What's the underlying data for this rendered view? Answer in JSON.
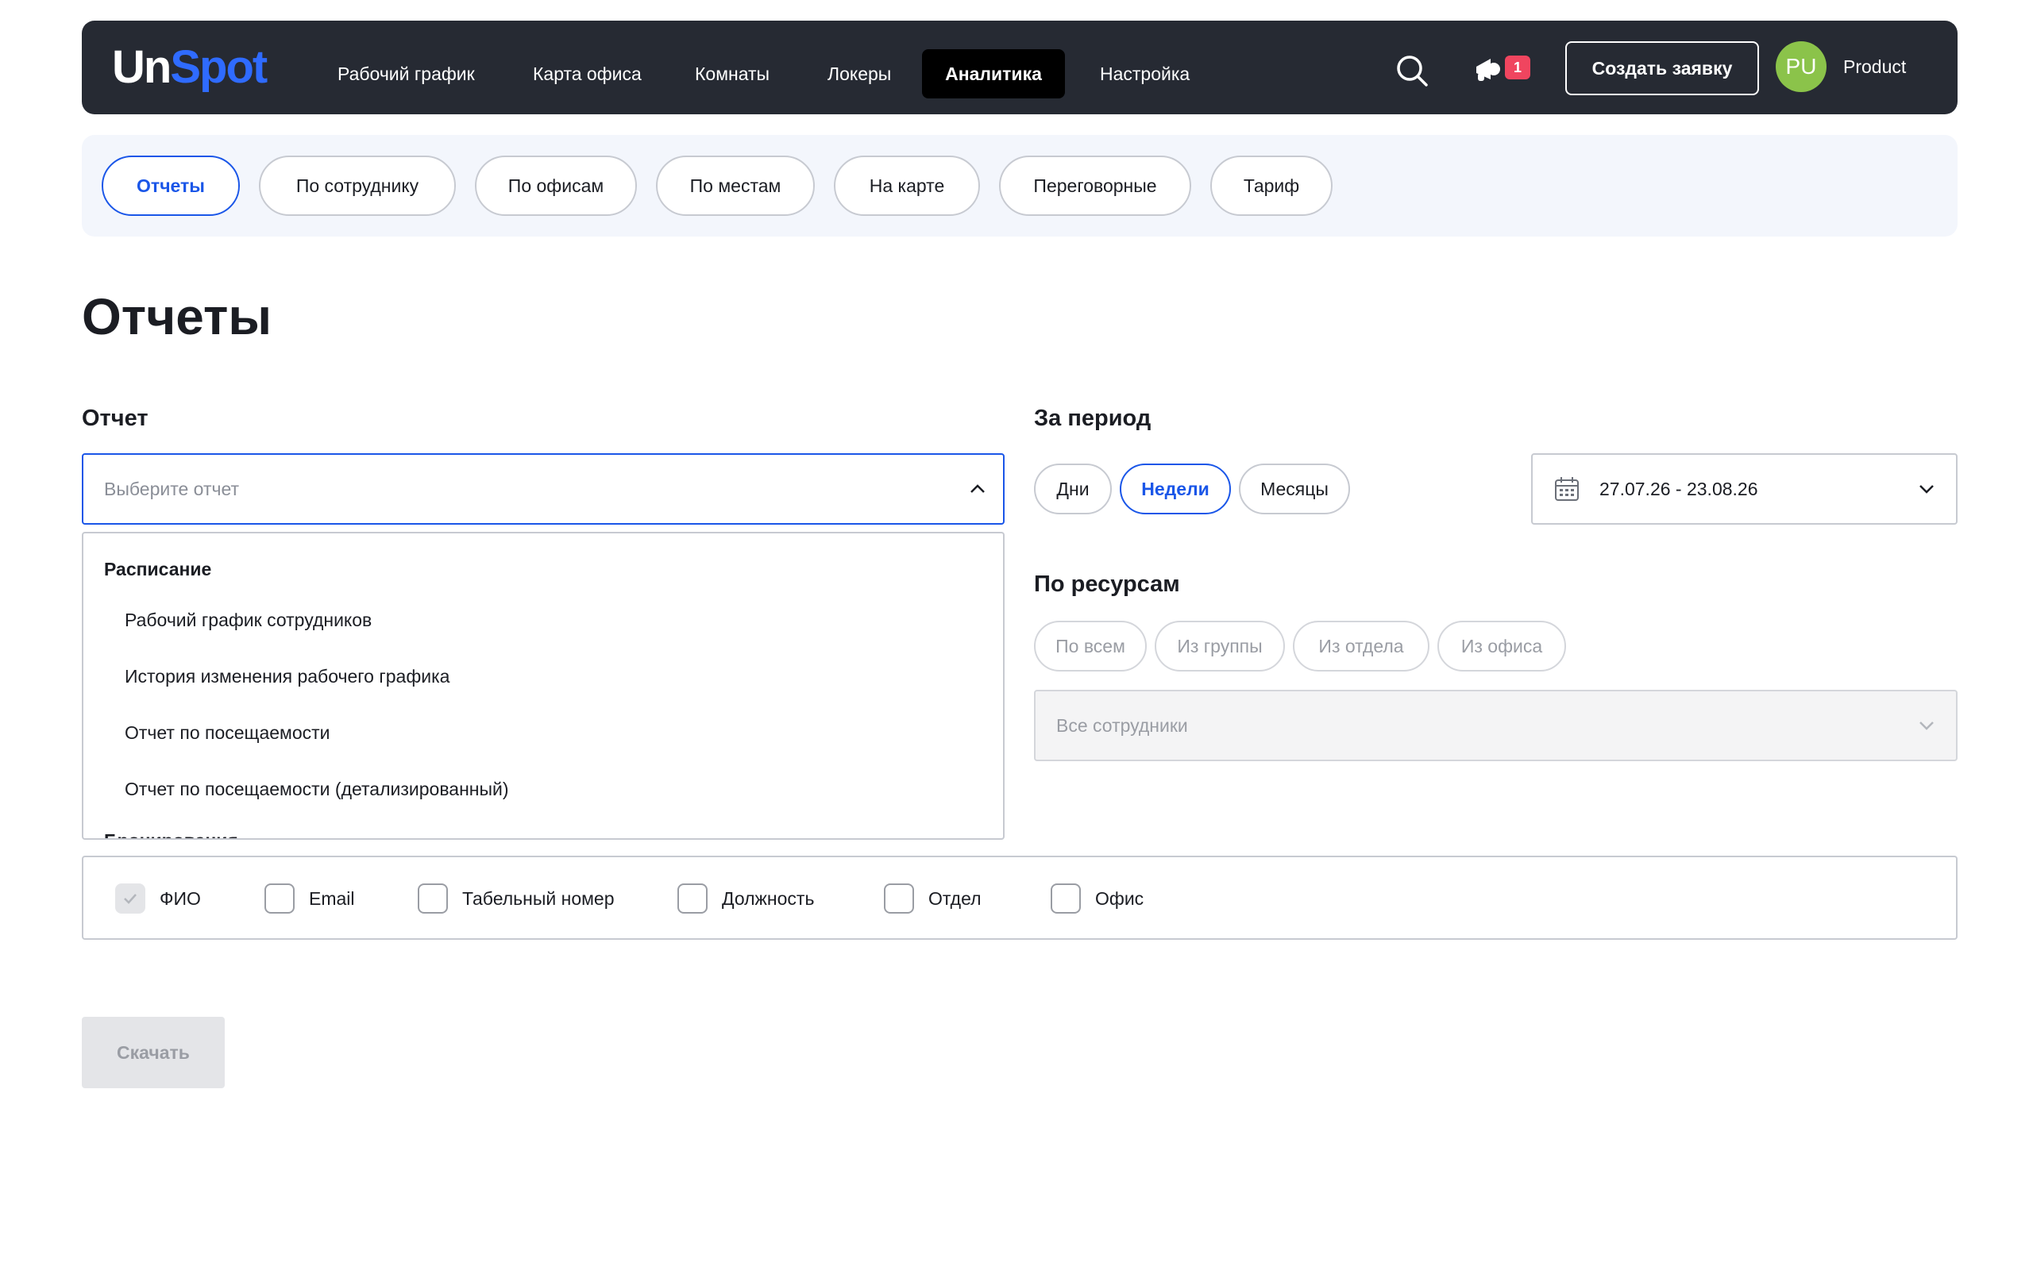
{
  "app": {
    "logo_un": "Un",
    "logo_spot": "Spot",
    "nav": [
      "Рабочий график",
      "Карта офиса",
      "Комнаты",
      "Локеры",
      "Аналитика",
      "Настройка"
    ],
    "active_nav": "Аналитика",
    "notifications_count": "1",
    "create_button": "Создать заявку",
    "avatar_initials": "PU",
    "user_name": "Product",
    "colors": {
      "topbar": "#262a33",
      "accent": "#1a56e8",
      "logo_accent": "#2f6bff",
      "badge": "#f0455f",
      "avatar": "#8bc34a"
    }
  },
  "tabs": [
    "Отчеты",
    "По сотруднику",
    "По офисам",
    "По местам",
    "На карте",
    "Переговорные",
    "Тариф"
  ],
  "active_tab": "Отчеты",
  "page_title": "Отчеты",
  "report": {
    "label": "Отчет",
    "placeholder": "Выберите отчет",
    "dropdown": {
      "group1": "Расписание",
      "items": [
        "Рабочий график сотрудников",
        "История изменения рабочего графика",
        "Отчет по посещаемости",
        "Отчет по посещаемости (детализированный)"
      ],
      "group2": "Бронирования"
    }
  },
  "period": {
    "label": "За период",
    "options": [
      "Дни",
      "Недели",
      "Месяцы"
    ],
    "selected": "Недели",
    "date_range": "27.07.26 - 23.08.26"
  },
  "resources": {
    "label": "По ресурсам",
    "options": [
      "По всем",
      "Из группы",
      "Из отдела",
      "Из офиса"
    ],
    "employees_placeholder": "Все сотрудники"
  },
  "columns": [
    {
      "label": "ФИО",
      "checked": true
    },
    {
      "label": "Email",
      "checked": false
    },
    {
      "label": "Табельный номер",
      "checked": false
    },
    {
      "label": "Должность",
      "checked": false
    },
    {
      "label": "Отдел",
      "checked": false
    },
    {
      "label": "Офис",
      "checked": false
    }
  ],
  "download_button": "Скачать"
}
